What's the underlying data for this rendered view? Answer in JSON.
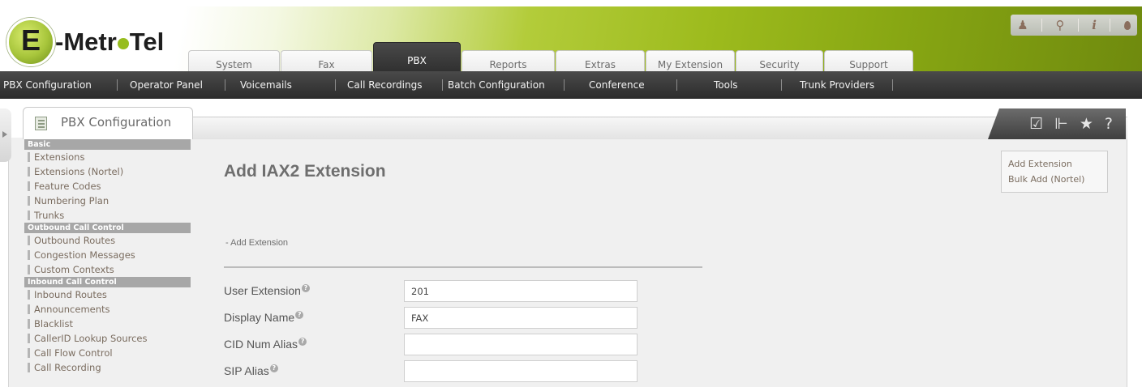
{
  "header": {
    "logo_letter": "E",
    "logo_pre": "-Metr",
    "logo_post": "Tel",
    "utility_icons": [
      "user-icon",
      "search-icon",
      "info-icon",
      "drop-icon"
    ],
    "utility_glyphs": [
      "♟",
      "⚲",
      "i",
      "💧"
    ]
  },
  "tabs": [
    {
      "label": "System",
      "active": false
    },
    {
      "label": "Fax",
      "active": false
    },
    {
      "label": "PBX",
      "active": true
    },
    {
      "label": "Reports",
      "active": false
    },
    {
      "label": "Extras",
      "active": false
    },
    {
      "label": "My Extension",
      "active": false
    },
    {
      "label": "Security",
      "active": false
    },
    {
      "label": "Support",
      "active": false
    }
  ],
  "submenu": [
    "PBX Configuration",
    "Operator Panel",
    "Voicemails",
    "Call Recordings",
    "Batch Configuration",
    "Conference",
    "Tools",
    "Trunk Providers"
  ],
  "page": {
    "tab_label": "PBX Configuration",
    "action_icons": [
      "edit-icon",
      "dock-icon",
      "star-icon",
      "help-icon"
    ],
    "action_glyphs": [
      "☑",
      "⊩",
      "★",
      "?"
    ]
  },
  "nav": {
    "sections": [
      {
        "title": "Basic",
        "items": [
          "Extensions",
          "Extensions (Nortel)",
          "Feature Codes",
          "Numbering Plan",
          "Trunks"
        ]
      },
      {
        "title": "Outbound Call Control",
        "items": [
          "Outbound Routes",
          "Congestion Messages",
          "Custom Contexts"
        ]
      },
      {
        "title": "Inbound Call Control",
        "items": [
          "Inbound Routes",
          "Announcements",
          "Blacklist",
          "CallerID Lookup Sources",
          "Call Flow Control",
          "Call Recording"
        ]
      }
    ]
  },
  "form": {
    "title": "Add IAX2 Extension",
    "section": "- Add Extension",
    "fields": [
      {
        "label": "User Extension",
        "value": ""
      },
      {
        "label": "Display Name",
        "value": ""
      },
      {
        "label": "CID Num Alias",
        "value": ""
      },
      {
        "label": "SIP Alias",
        "value": ""
      }
    ],
    "help_glyph": "?"
  },
  "sidebox": {
    "links": [
      "Add Extension",
      "Bulk Add (Nortel)"
    ]
  },
  "values": {
    "user_extension": "201",
    "display_name": "FAX"
  }
}
